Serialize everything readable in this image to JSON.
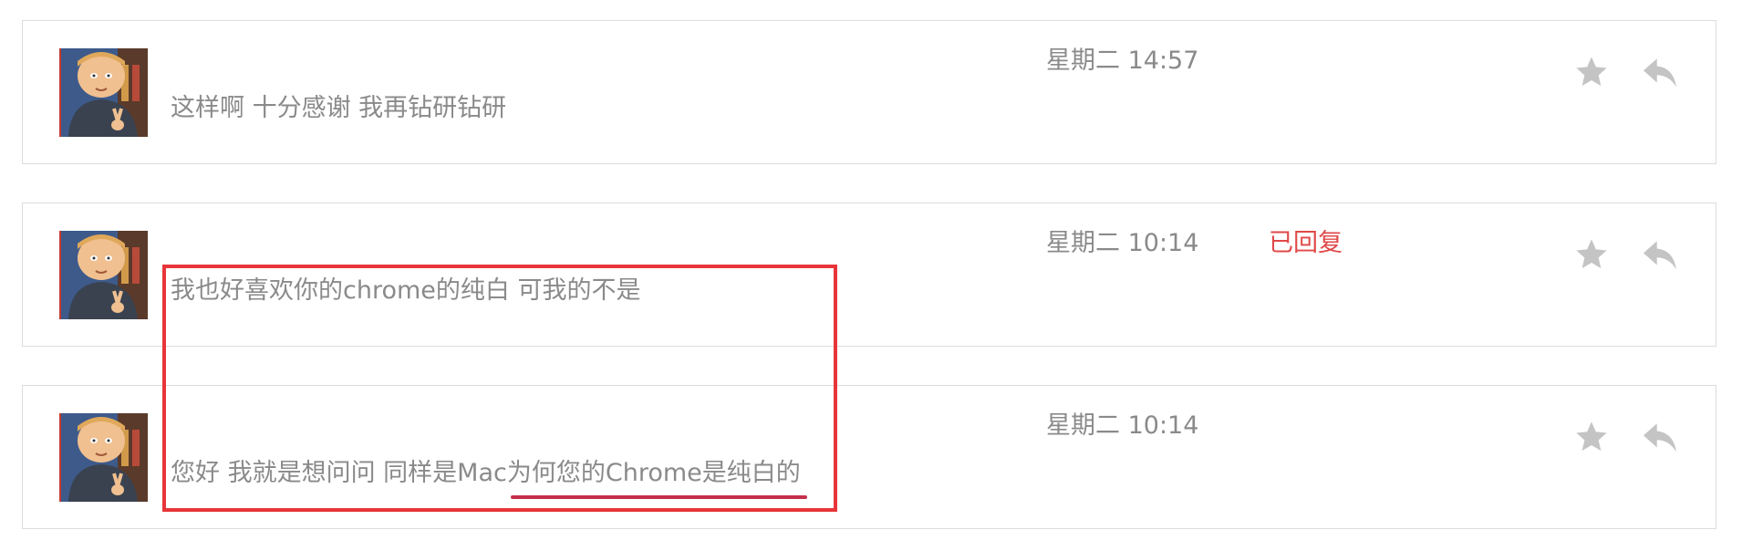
{
  "messages": [
    {
      "text": "这样啊 十分感谢 我再钻研钻研",
      "time": "星期二 14:57",
      "status": ""
    },
    {
      "text": "我也好喜欢你的chrome的纯白 可我的不是",
      "time": "星期二 10:14",
      "status": "已回复"
    },
    {
      "text": "您好 我就是想问问 同样是Mac为何您的Chrome是纯白的",
      "time": "星期二 10:14",
      "status": ""
    }
  ],
  "icons": {
    "avatar": "avatar-image",
    "star": "star-icon",
    "reply": "reply-arrow-icon"
  },
  "colors": {
    "text": "#8a8a8a",
    "status": "#e04848",
    "icon": "#c4c4c4",
    "annotation": "#e8353a",
    "border": "#dcdcdc"
  }
}
